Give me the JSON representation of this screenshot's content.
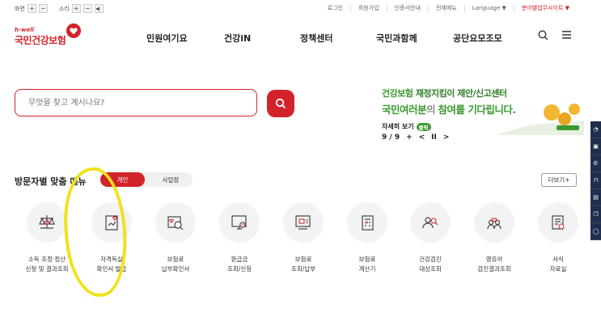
{
  "topbar": {
    "zoom_label": "화면",
    "sound_label": "소리",
    "plus": "+",
    "minus": "−",
    "links": [
      "로그인",
      "회원가입",
      "인증서안내",
      "전체메뉴",
      "Language ▼"
    ],
    "site_link": "분야별업무사이트 ▼"
  },
  "logo": {
    "small": "h-well",
    "big": "국민건강보험"
  },
  "gnb": [
    "민원여기요",
    "건강iN",
    "정책센터",
    "국민과함께",
    "공단요모조모"
  ],
  "search": {
    "placeholder": "무엇을 찾고 계시나요?"
  },
  "banner": {
    "line1_green": "건강보험",
    "line1_bold": " 재정지킴이 제안/신고센터",
    "line2_a": "국민여러분",
    "line2_b": "의 ",
    "line2_c": "참여를 기다립니다.",
    "more_label": "자세히 보기",
    "more_pill": "클릭",
    "counter": "9 / 9",
    "plus": "+",
    "prev": "<",
    "pause": "II",
    "next": ">"
  },
  "section": {
    "title": "방문자별 맞춤 메뉴",
    "tab_personal": "개인",
    "tab_business": "사업장",
    "more": "더보기+"
  },
  "menu": [
    {
      "label": "소득 조정·정산\n신청 및 결과조회",
      "icon": "scale-icon"
    },
    {
      "label": "자격득실\n확인서 발급",
      "icon": "certificate-icon"
    },
    {
      "label": "보험료\n납부확인서",
      "icon": "receipt-search-icon"
    },
    {
      "label": "환급금\n조회/신청",
      "icon": "refund-monitor-icon"
    },
    {
      "label": "보험료\n조회/납부",
      "icon": "payment-monitor-icon"
    },
    {
      "label": "보험료\n계산기",
      "icon": "calculator-icon"
    },
    {
      "label": "건강검진\n대상조회",
      "icon": "people-search-icon"
    },
    {
      "label": "영유아\n검진결과조회",
      "icon": "family-icon"
    },
    {
      "label": "서식\n자료실",
      "icon": "document-form-icon"
    }
  ],
  "colors": {
    "brand": "#d2232a",
    "green": "#3a9a2e",
    "highlight": "#f0e21b",
    "sidebar": "#1f2f4d"
  }
}
